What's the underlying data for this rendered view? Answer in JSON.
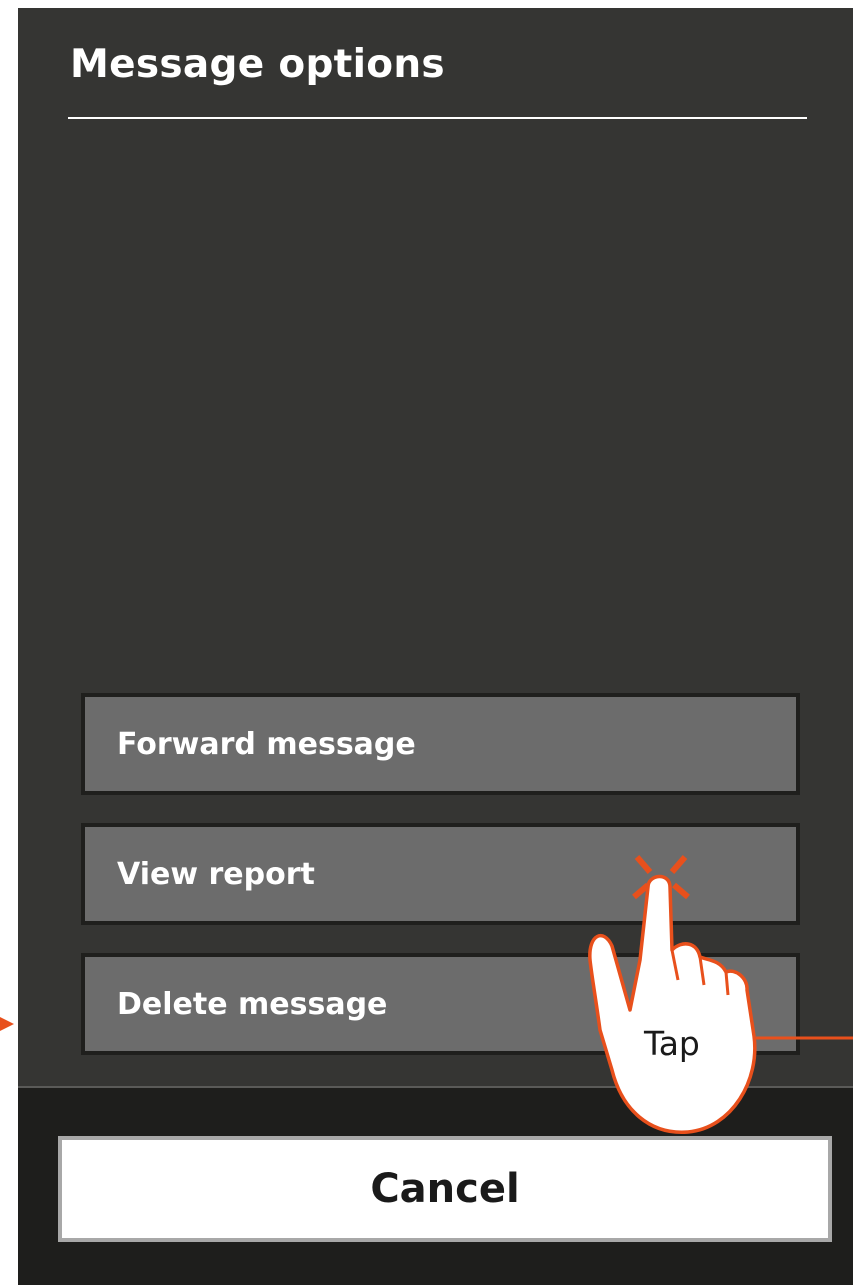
{
  "sheet": {
    "title": "Message options",
    "options": [
      {
        "label": "Forward message"
      },
      {
        "label": "View report"
      },
      {
        "label": "Delete message"
      }
    ],
    "cancel_label": "Cancel"
  },
  "annotation": {
    "gesture": "hand-tap-icon",
    "label": "Tap",
    "accent_color": "#e8501c"
  },
  "colors": {
    "panel_bg": "#353533",
    "option_bg": "#6c6c6c",
    "footer_bg": "#1e1e1c",
    "cancel_bg": "#ffffff"
  }
}
